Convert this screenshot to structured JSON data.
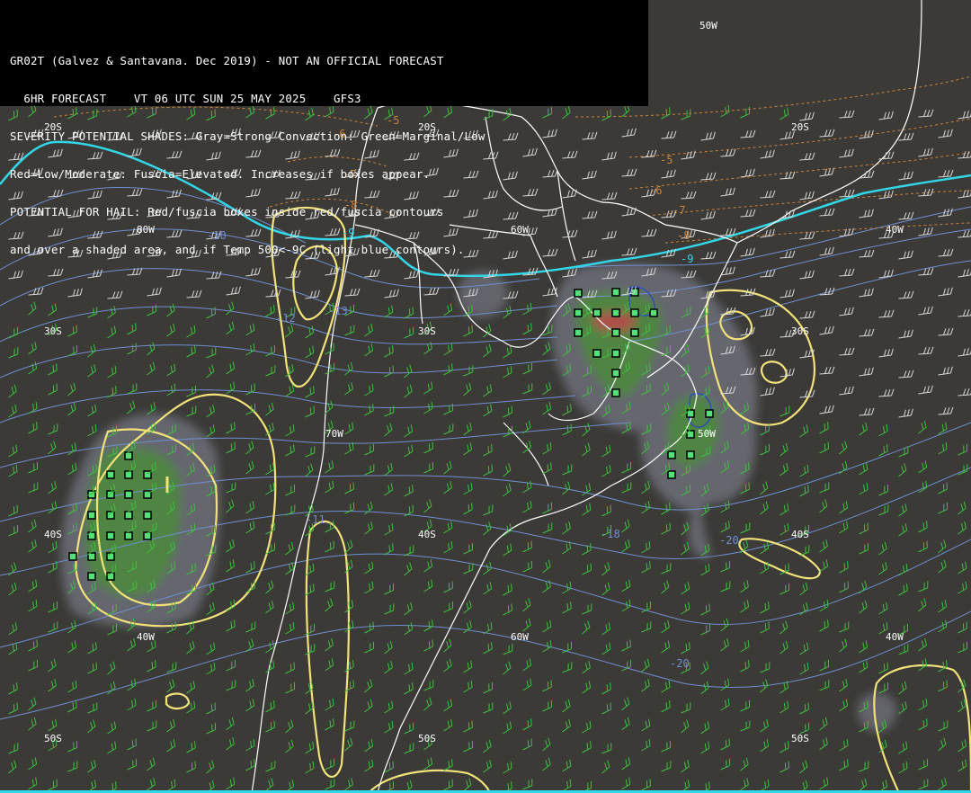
{
  "header": {
    "line1": "GR02T (Galvez & Santavana. Dec 2019) - NOT AN OFFICIAL FORECAST",
    "line2": "  6HR FORECAST    VT 06 UTC SUN 25 MAY 2025    GFS3",
    "line3": "SEVERITY POTENTIAL SHADES: Gray=Strong Convection: Green=Marginal/Low",
    "line4": "Red=Low/Moderate: Fuscia=Elevated. Increases if boxes appear.",
    "line5": "POTENTIAL FOR HAIL: Red/fuscia boxes inside red/fuscia contours",
    "line6": "and over a shaded area, and if Temp 500<-9C (light blue contours)."
  },
  "grid_labels": {
    "lat_20s_a": "20S",
    "lat_20s_b": "20S",
    "lat_20s_c": "20S",
    "lat_30s_a": "30S",
    "lat_30s_b": "30S",
    "lat_30s_c": "30S",
    "lat_40s_a": "40S",
    "lat_40s_b": "40S",
    "lat_40s_c": "40S",
    "lat_50s_a": "50S",
    "lat_50s_b": "50S",
    "lat_50s_c": "50S",
    "lon_80w": "80W",
    "lon_60w_a": "60W",
    "lon_40w_a": "40W",
    "lon_70w": "70W",
    "lon_50w_a": "50W",
    "lon_50w_b": "50W",
    "lon_40w_b": "40W",
    "lon_60w_b": "60W",
    "lon_40w_c": "40W"
  },
  "contour_labels": {
    "t_m5a": "-5",
    "t_m6a": "-6",
    "t_m7a": "-7",
    "t_m8a": "-8",
    "t_m5b": "-5",
    "t_m6b": "-6",
    "t_m7b": "-7",
    "t_m8b": "-8",
    "b_m10": "-10",
    "b_m9": "-9",
    "b_m12": "-12",
    "b_m13": "-13",
    "b_m14": "-14",
    "b_m11": "-11",
    "b_m18": "-18",
    "b_m20a": "-20",
    "b_m20b": "-20",
    "c_m9a": "-9",
    "c_m9b": "-9"
  },
  "colors": {
    "background": "#3b3a37",
    "coast": "#ffffff",
    "cyan_contour": "#33d6e6",
    "blue_contour": "#6f8fd0",
    "orange_contour": "#c8823a",
    "yellow_contour": "#f2e27a",
    "shade_gray": "#6d6e78",
    "shade_green": "#4c8a3c",
    "shade_red": "#b84a4a",
    "box": "#55e07a",
    "barb_green": "#3fbf3f",
    "barb_white": "#d8d8d8"
  }
}
